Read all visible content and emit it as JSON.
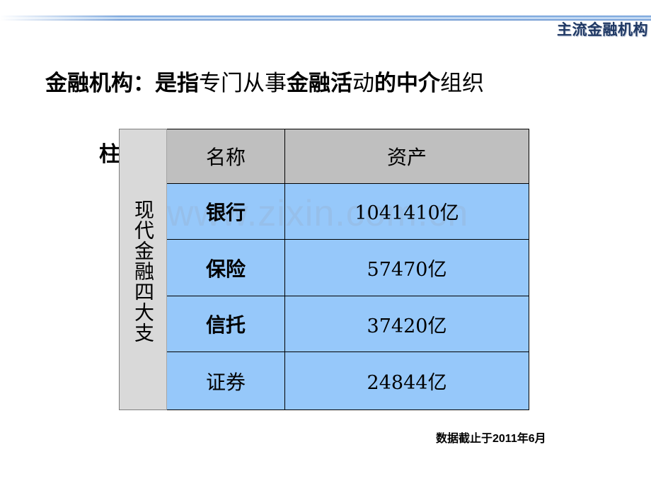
{
  "header": {
    "title": "主流金融机构",
    "title_color": "#1F3864",
    "rule_color": "#7BA7DE"
  },
  "statement": {
    "segments": [
      {
        "text": "金融机构：是指",
        "weight": "heavy"
      },
      {
        "text": "专门从事",
        "weight": "light"
      },
      {
        "text": "金融活",
        "weight": "heavy"
      },
      {
        "text": "动",
        "weight": "light"
      },
      {
        "text": "的中介",
        "weight": "heavy"
      },
      {
        "text": "组织",
        "weight": "light"
      }
    ],
    "full_text": "金融机构：是指专门从事金融活动的中介组织"
  },
  "stray_char": "柱",
  "table": {
    "vertical_label": "现代金融四大支",
    "header_bg": "#BFBFBF",
    "row_bg": "#96C8FA",
    "label_bg": "#D9D9D9",
    "columns": [
      "名称",
      "资产"
    ],
    "rows": [
      {
        "name": "银行",
        "asset": "1041410亿",
        "name_weight": "heavy"
      },
      {
        "name": "保险",
        "asset": "57470亿",
        "name_weight": "heavy"
      },
      {
        "name": "信托",
        "asset": "37420亿",
        "name_weight": "heavy"
      },
      {
        "name": "证券",
        "asset": "24844亿",
        "name_weight": "light"
      }
    ]
  },
  "watermark": {
    "text": "www.zixin.com.cn"
  },
  "footnote": {
    "text": "数据截止于2011年6月"
  }
}
